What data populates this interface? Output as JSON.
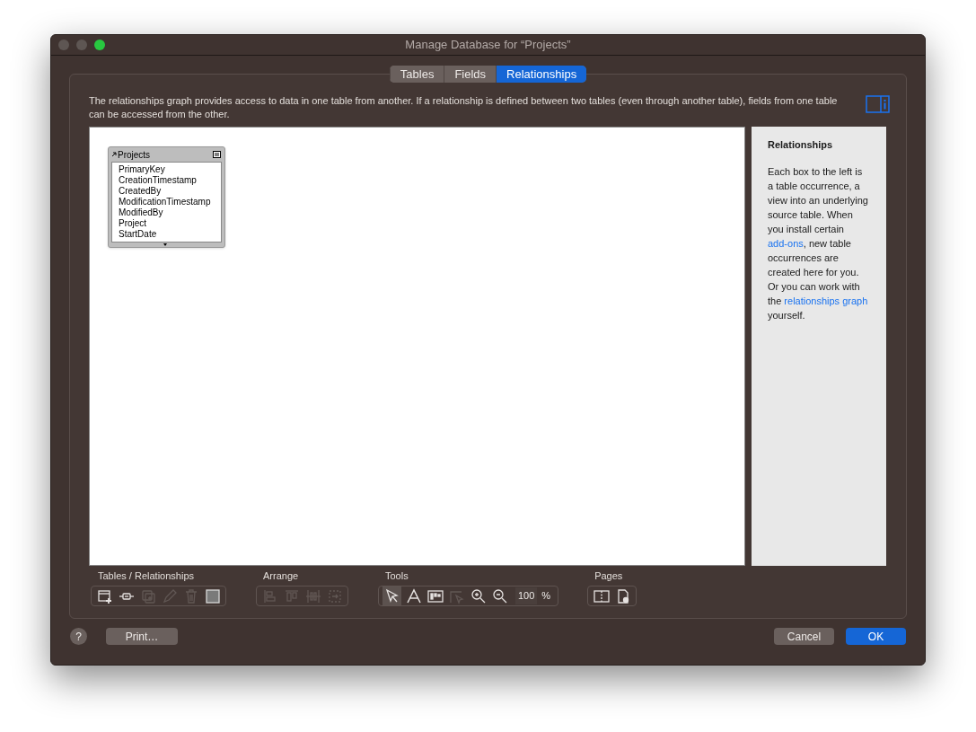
{
  "window": {
    "title": "Manage Database for “Projects”"
  },
  "tabs": [
    {
      "label": "Tables",
      "selected": false
    },
    {
      "label": "Fields",
      "selected": false
    },
    {
      "label": "Relationships",
      "selected": true
    }
  ],
  "description": "The relationships graph provides access to data in one table from another. If a relationship is defined between two tables (even through another table), fields from one table can be accessed from the other.",
  "table_occurrence": {
    "name": "Projects",
    "fields": [
      "PrimaryKey",
      "CreationTimestamp",
      "CreatedBy",
      "ModificationTimestamp",
      "ModifiedBy",
      "Project",
      "StartDate"
    ]
  },
  "sidebar": {
    "title": "Relationships",
    "parts": [
      {
        "kind": "text",
        "text": "Each box to the left is a table occurrence, a view into an underlying source table. When you install certain "
      },
      {
        "kind": "link",
        "text": "add-ons"
      },
      {
        "kind": "text",
        "text": ", new table occurrences are created here for you. Or you can work with the "
      },
      {
        "kind": "link",
        "text": "relationships graph"
      },
      {
        "kind": "text",
        "text": " yourself."
      }
    ]
  },
  "toolbar_groups": [
    {
      "label": "Tables / Relationships",
      "tools": [
        {
          "kind": "add-table",
          "disabled": false,
          "selected": false
        },
        {
          "kind": "add-relationship",
          "disabled": false,
          "selected": false
        },
        {
          "kind": "duplicate",
          "disabled": true,
          "selected": false
        },
        {
          "kind": "edit",
          "disabled": true,
          "selected": false
        },
        {
          "kind": "delete",
          "disabled": true,
          "selected": false
        },
        {
          "kind": "color",
          "disabled": false,
          "selected": false
        }
      ]
    },
    {
      "label": "Arrange",
      "tools": [
        {
          "kind": "align",
          "disabled": true,
          "selected": false
        },
        {
          "kind": "align-top",
          "disabled": true,
          "selected": false
        },
        {
          "kind": "distribute",
          "disabled": true,
          "selected": false
        },
        {
          "kind": "resize",
          "disabled": true,
          "selected": false
        }
      ]
    },
    {
      "label": "Tools",
      "tools": [
        {
          "kind": "pointer",
          "disabled": false,
          "selected": true
        },
        {
          "kind": "text",
          "disabled": false,
          "selected": false
        },
        {
          "kind": "note",
          "disabled": false,
          "selected": false
        },
        {
          "kind": "select-related",
          "disabled": true,
          "selected": false
        },
        {
          "kind": "zoom-in",
          "disabled": false,
          "selected": false
        },
        {
          "kind": "zoom-out",
          "disabled": false,
          "selected": false
        }
      ],
      "zoom": {
        "value": "100",
        "unit": "%"
      }
    },
    {
      "label": "Pages",
      "tools": [
        {
          "kind": "page-breaks",
          "disabled": false,
          "selected": false
        },
        {
          "kind": "page-setup",
          "disabled": false,
          "selected": false
        }
      ]
    }
  ],
  "buttons": {
    "help": "?",
    "print": "Print…",
    "cancel": "Cancel",
    "ok": "OK"
  }
}
